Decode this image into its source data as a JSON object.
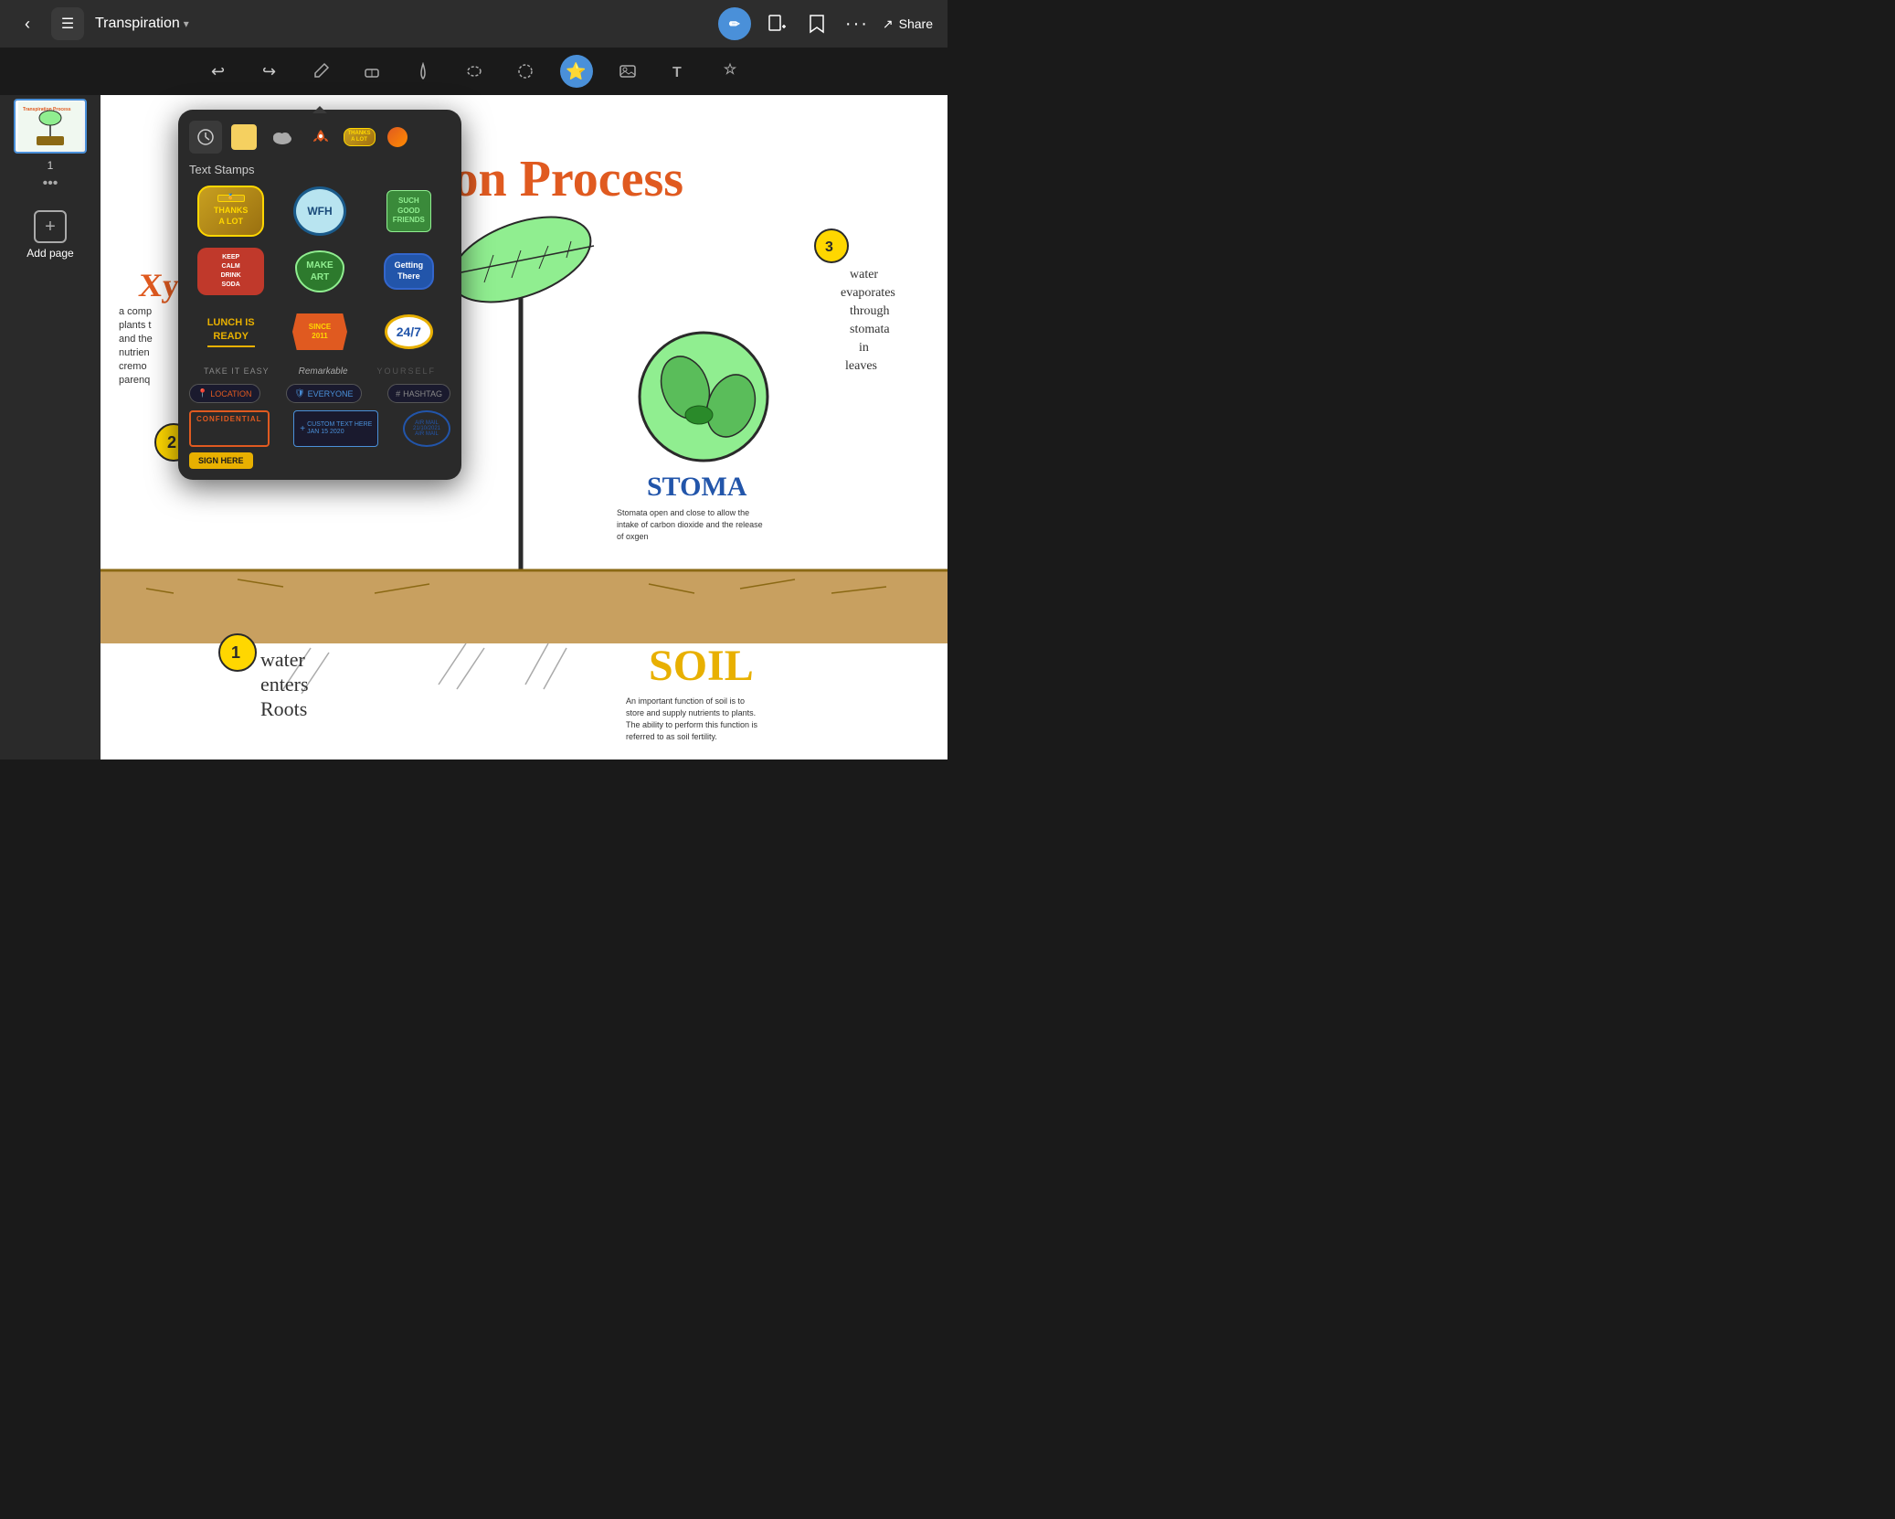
{
  "header": {
    "back_label": "‹",
    "app_icon": "☰",
    "doc_title": "Transpiration",
    "chevron": "▾",
    "avatar_initials": "✏",
    "icons": {
      "add_page": "+",
      "bookmark": "🔖",
      "more": "•••",
      "share": "Share",
      "share_icon": "↗"
    }
  },
  "toolbar": {
    "undo": "↩",
    "redo": "↪",
    "pencil": "✏",
    "eraser": "⬜",
    "pen": "🖊",
    "lasso": "⭕",
    "select": "⌘",
    "star_sticker": "⭐",
    "image": "🖼",
    "text": "T",
    "magic": "✨"
  },
  "sidebar": {
    "page_number": "1",
    "more_label": "•••",
    "add_page_label": "Add page"
  },
  "sticker_popup": {
    "section_title": "Text Stamps",
    "tabs": [
      {
        "id": "recent",
        "icon": "🕐"
      },
      {
        "id": "color",
        "type": "color"
      },
      {
        "id": "cloud",
        "icon": "☁"
      },
      {
        "id": "rocket",
        "icon": "🚀"
      },
      {
        "id": "thanks",
        "icon": "🏅"
      },
      {
        "id": "orange",
        "icon": "🍊"
      }
    ],
    "stickers": [
      {
        "id": "thanks-a-lot",
        "label": "THANKS\nA LOT",
        "type": "thanks"
      },
      {
        "id": "wfh",
        "label": "WFH",
        "type": "wfh"
      },
      {
        "id": "such-good-friends",
        "label": "SUCH\nGOOD\nFRIENDS",
        "type": "good"
      },
      {
        "id": "keep-calm",
        "label": "KEEP\nCALM\nDRINK\nSODA",
        "type": "calm"
      },
      {
        "id": "make-art",
        "label": "MAKE\nART",
        "type": "art"
      },
      {
        "id": "getting-there",
        "label": "Getting\nThere",
        "type": "getting"
      },
      {
        "id": "lunch-is-ready",
        "label": "LUNCH IS\nREADY",
        "type": "lunch"
      },
      {
        "id": "since-2011",
        "label": "SINCE\n2011",
        "type": "since"
      },
      {
        "id": "247",
        "label": "24/7",
        "type": "247"
      }
    ],
    "text_stamps": [
      {
        "id": "take-it-easy",
        "label": "TAKE IT EASY"
      },
      {
        "id": "remarkable",
        "label": "Remarkable"
      },
      {
        "id": "yourself",
        "label": "YOURSELF"
      }
    ],
    "badges": [
      {
        "id": "location",
        "icon": "📍",
        "label": "LOCATION"
      },
      {
        "id": "everyone",
        "icon": "🛡",
        "label": "EVERYONE"
      },
      {
        "id": "hashtag",
        "icon": "#",
        "label": "HASHTAG"
      }
    ],
    "stamps": [
      {
        "id": "confidential",
        "label": "CONFIDENTIAL"
      },
      {
        "id": "custom-text",
        "label": "CUSTOM TEXT HERE\nJAN 15 2020"
      },
      {
        "id": "air-mail",
        "label": "AIR MAIL\n21/10/2021\nAIR MAIL"
      }
    ],
    "bottom_stamps": [
      {
        "id": "sign-here",
        "label": "SIGN\nHERE"
      }
    ]
  },
  "canvas": {
    "title_part1": "ion Process",
    "annotation_xy": "Xy",
    "annotation_water_evaporates": "3\nwater\nevaporates\nthrough\nstomata\nin\nleaves",
    "annotation_stoma_title": "STOMA",
    "annotation_stoma_desc": "Stomata open and close to allow the\nintake of carbon dioxide and the release\nof oxgen",
    "annotation_water_enters": "1\nwater\nenters\nRoots",
    "annotation_soil_title": "SOIL",
    "annotation_soil_desc": "An important function of soil is to\nstore and supply nutrients to plants.\nThe ability to perform this function is\nreferred to as soil fertility.",
    "annotation_2_label": "2"
  }
}
